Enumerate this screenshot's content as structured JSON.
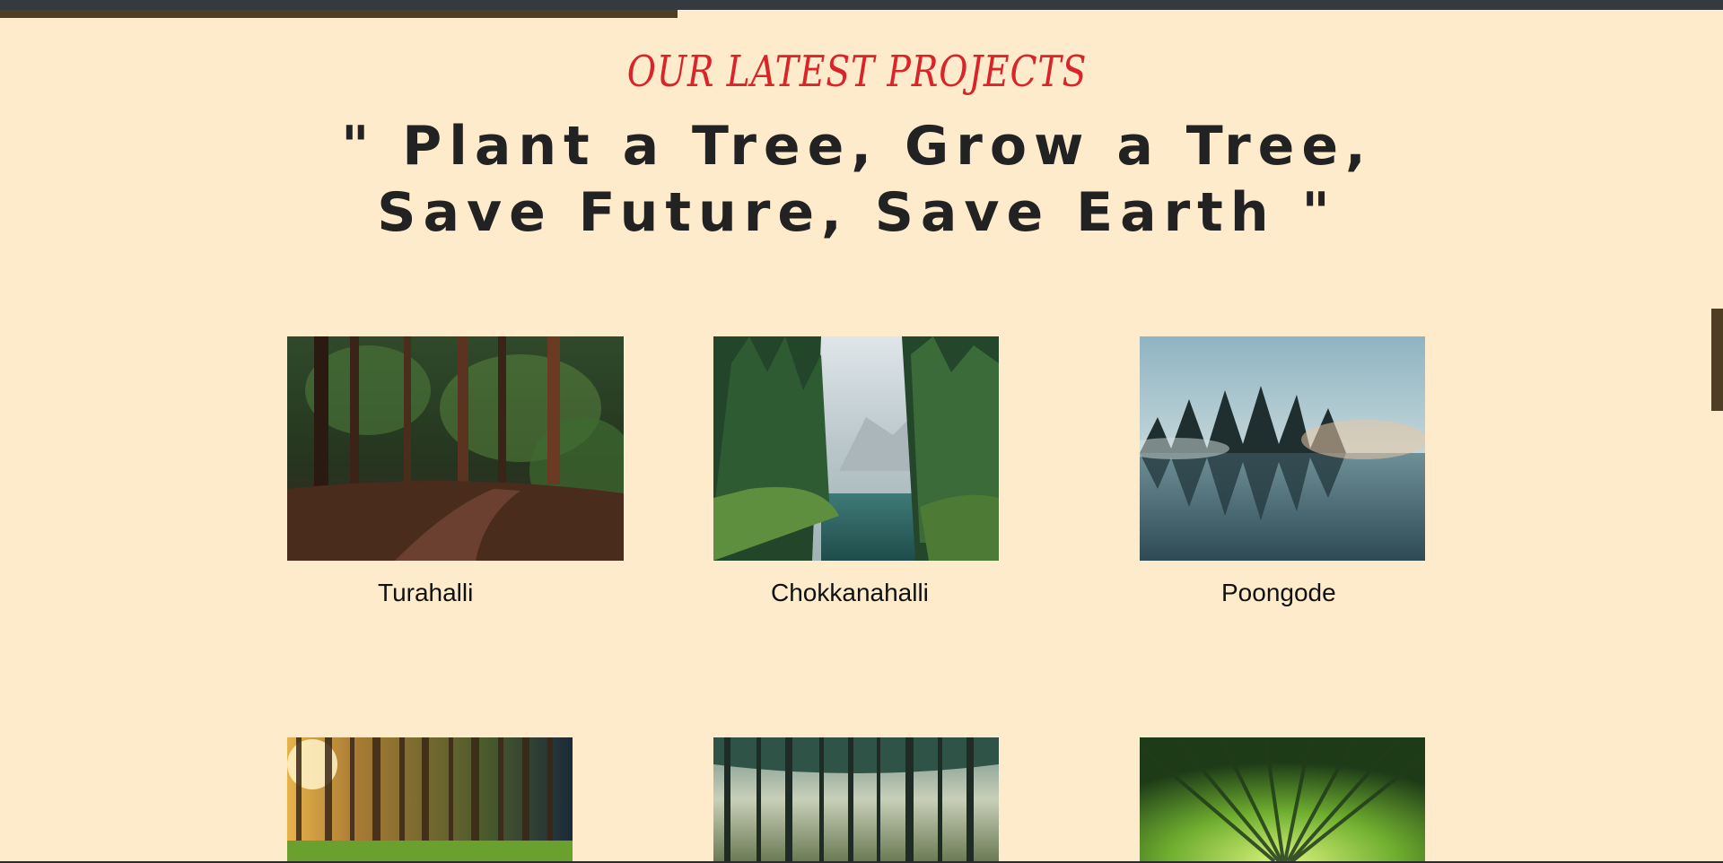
{
  "section": {
    "subtitle": "OUR LATEST PROJECTS",
    "headline_line1": "\" Plant a Tree, Grow a Tree,",
    "headline_line2": "Save Future, Save Earth \""
  },
  "projects": [
    {
      "name": "Turahalli",
      "image": "forest-path-photo"
    },
    {
      "name": "Chokkanahalli",
      "image": "forest-lake-photo"
    },
    {
      "name": "Poongode",
      "image": "misty-lake-photo"
    },
    {
      "name": "",
      "image": "sunlit-forest-photo"
    },
    {
      "name": "",
      "image": "tall-pines-photo"
    },
    {
      "name": "",
      "image": "bamboo-canopy-photo"
    }
  ],
  "colors": {
    "background": "#FEEBCC",
    "accent": "#D9252A",
    "brown": "#4E3E24",
    "topbar": "#343A40"
  }
}
